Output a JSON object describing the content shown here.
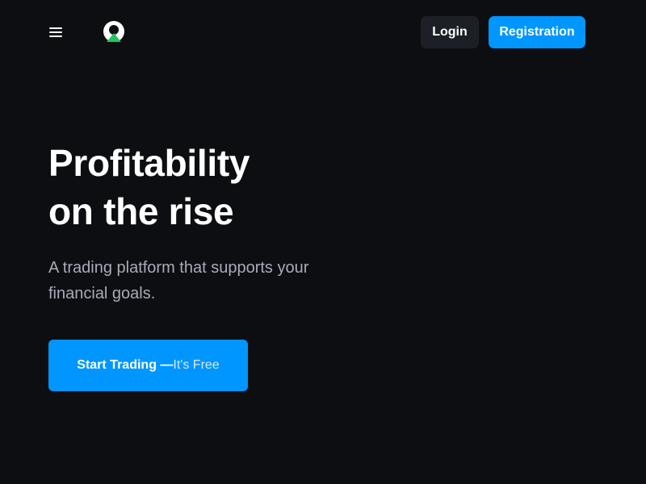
{
  "header": {
    "login_label": "Login",
    "register_label": "Registration"
  },
  "hero": {
    "title_line1": "Profitability",
    "title_line2": "on the rise",
    "subtitle": "A trading platform that supports your financial goals.",
    "cta_main": "Start Trading —",
    "cta_free": "It's Free"
  },
  "icons": {
    "menu": "menu-icon",
    "logo": "brand-logo-icon"
  },
  "colors": {
    "background": "#0d0e12",
    "accent": "#0096ff",
    "login_bg": "#1c1f26",
    "subtitle": "#a7acb7",
    "logo_green": "#22c55e"
  }
}
